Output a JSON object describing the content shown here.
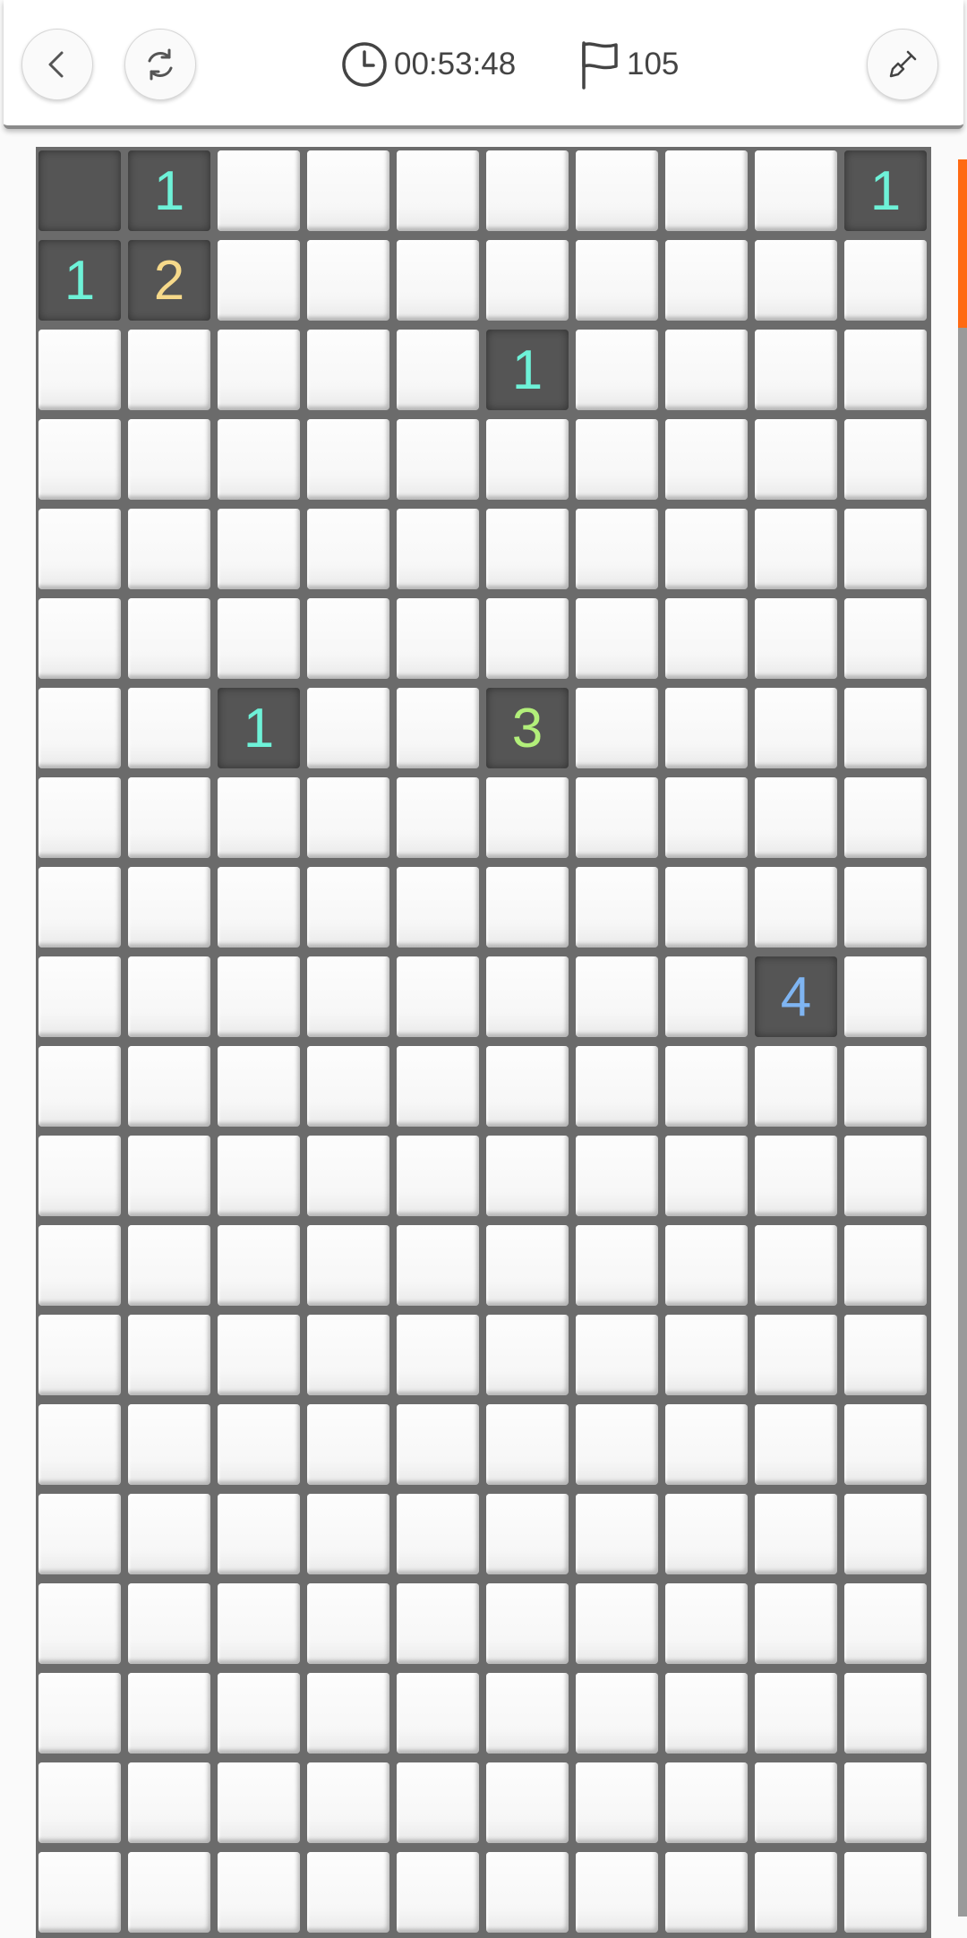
{
  "header": {
    "timer": "00:53:48",
    "flags": "105"
  },
  "icons": {
    "back": "chevron-left-icon",
    "restart": "refresh-icon",
    "timer": "clock-icon",
    "flags": "flag-icon",
    "tool": "shovel-icon"
  },
  "colors": {
    "number_1": "#6ef2d8",
    "number_2": "#f6d98a",
    "number_3": "#b2ef7a",
    "number_4": "#7fb5f2",
    "scroll_accent": "#ff6a13"
  },
  "board": {
    "columns": 10,
    "rows": [
      [
        "e",
        "1",
        "h",
        "h",
        "h",
        "h",
        "h",
        "h",
        "h",
        "1"
      ],
      [
        "1",
        "2",
        "h",
        "h",
        "h",
        "h",
        "h",
        "h",
        "h",
        "h"
      ],
      [
        "h",
        "h",
        "h",
        "h",
        "h",
        "1",
        "h",
        "h",
        "h",
        "h"
      ],
      [
        "h",
        "h",
        "h",
        "h",
        "h",
        "h",
        "h",
        "h",
        "h",
        "h"
      ],
      [
        "h",
        "h",
        "h",
        "h",
        "h",
        "h",
        "h",
        "h",
        "h",
        "h"
      ],
      [
        "h",
        "h",
        "h",
        "h",
        "h",
        "h",
        "h",
        "h",
        "h",
        "h"
      ],
      [
        "h",
        "h",
        "1",
        "h",
        "h",
        "3",
        "h",
        "h",
        "h",
        "h"
      ],
      [
        "h",
        "h",
        "h",
        "h",
        "h",
        "h",
        "h",
        "h",
        "h",
        "h"
      ],
      [
        "h",
        "h",
        "h",
        "h",
        "h",
        "h",
        "h",
        "h",
        "h",
        "h"
      ],
      [
        "h",
        "h",
        "h",
        "h",
        "h",
        "h",
        "h",
        "h",
        "4",
        "h"
      ],
      [
        "h",
        "h",
        "h",
        "h",
        "h",
        "h",
        "h",
        "h",
        "h",
        "h"
      ],
      [
        "h",
        "h",
        "h",
        "h",
        "h",
        "h",
        "h",
        "h",
        "h",
        "h"
      ],
      [
        "h",
        "h",
        "h",
        "h",
        "h",
        "h",
        "h",
        "h",
        "h",
        "h"
      ],
      [
        "h",
        "h",
        "h",
        "h",
        "h",
        "h",
        "h",
        "h",
        "h",
        "h"
      ],
      [
        "h",
        "h",
        "h",
        "h",
        "h",
        "h",
        "h",
        "h",
        "h",
        "h"
      ],
      [
        "h",
        "h",
        "h",
        "h",
        "h",
        "h",
        "h",
        "h",
        "h",
        "h"
      ],
      [
        "h",
        "h",
        "h",
        "h",
        "h",
        "h",
        "h",
        "h",
        "h",
        "h"
      ],
      [
        "h",
        "h",
        "h",
        "h",
        "h",
        "h",
        "h",
        "h",
        "h",
        "h"
      ],
      [
        "h",
        "h",
        "h",
        "h",
        "h",
        "h",
        "h",
        "h",
        "h",
        "h"
      ],
      [
        "h",
        "h",
        "h",
        "h",
        "h",
        "h",
        "h",
        "h",
        "h",
        "h"
      ]
    ]
  },
  "scroll": {
    "position": 0.0
  }
}
